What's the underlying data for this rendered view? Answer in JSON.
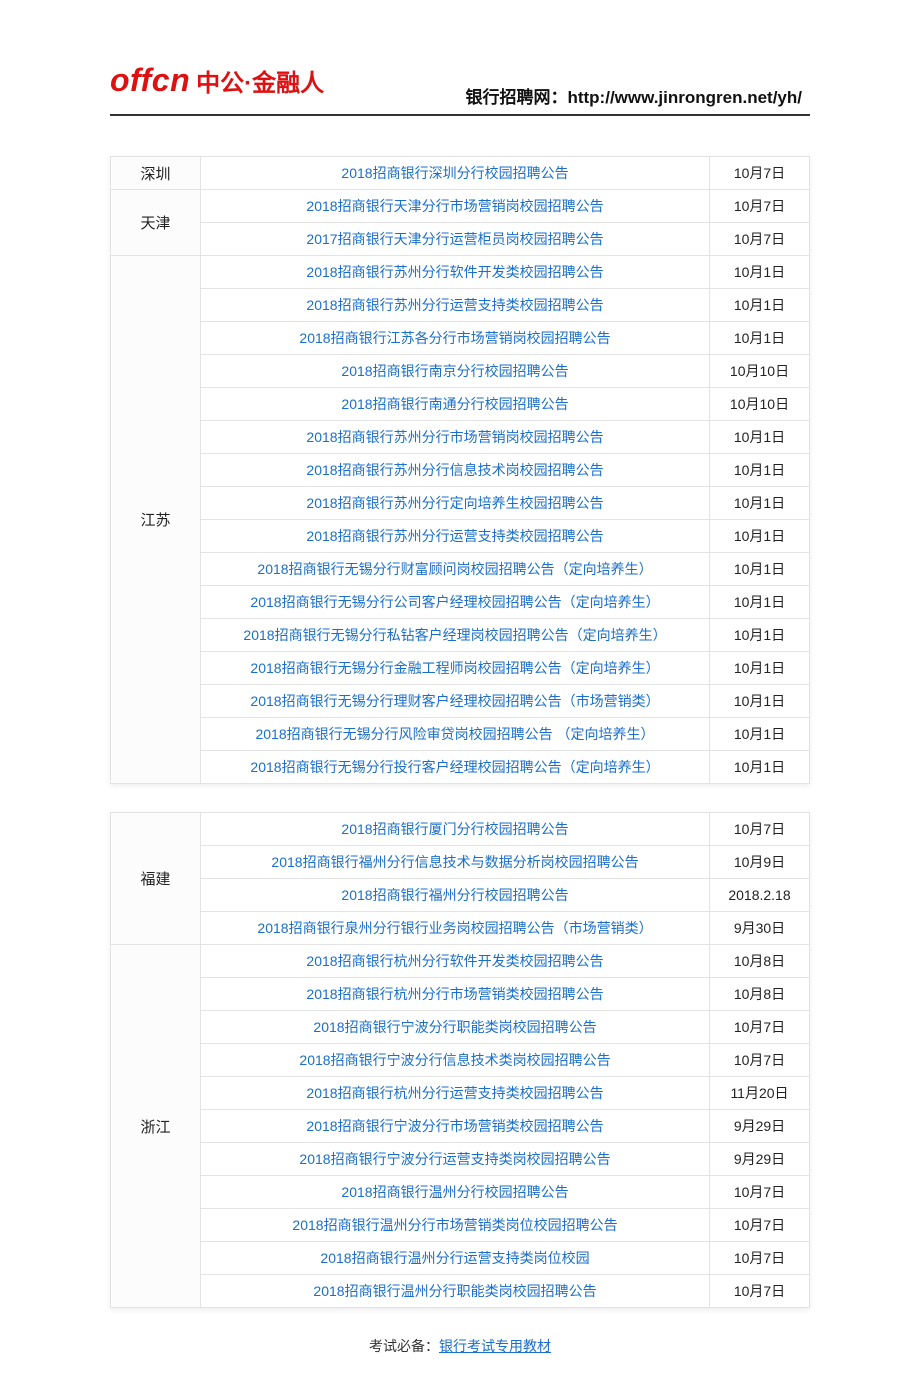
{
  "header": {
    "logo_offcn": "offcn",
    "logo_cn": "中公·金融人",
    "right_label": "银行招聘网：",
    "right_url": "http://www.jinrongren.net/yh/"
  },
  "table1": {
    "groups": [
      {
        "region": "深圳",
        "rows": [
          {
            "title": "2018招商银行深圳分行校园招聘公告",
            "date": "10月7日"
          }
        ]
      },
      {
        "region": "天津",
        "rows": [
          {
            "title": "2018招商银行天津分行市场营销岗校园招聘公告",
            "date": "10月7日"
          },
          {
            "title": "2017招商银行天津分行运营柜员岗校园招聘公告",
            "date": "10月7日"
          }
        ]
      },
      {
        "region": "江苏",
        "rows": [
          {
            "title": "2018招商银行苏州分行软件开发类校园招聘公告",
            "date": "10月1日"
          },
          {
            "title": "2018招商银行苏州分行运营支持类校园招聘公告",
            "date": "10月1日"
          },
          {
            "title": "2018招商银行江苏各分行市场营销岗校园招聘公告",
            "date": "10月1日"
          },
          {
            "title": "2018招商银行南京分行校园招聘公告",
            "date": "10月10日"
          },
          {
            "title": "2018招商银行南通分行校园招聘公告",
            "date": "10月10日"
          },
          {
            "title": "2018招商银行苏州分行市场营销岗校园招聘公告",
            "date": "10月1日"
          },
          {
            "title": "2018招商银行苏州分行信息技术岗校园招聘公告",
            "date": "10月1日"
          },
          {
            "title": "2018招商银行苏州分行定向培养生校园招聘公告",
            "date": "10月1日"
          },
          {
            "title": "2018招商银行苏州分行运营支持类校园招聘公告",
            "date": "10月1日"
          },
          {
            "title": "2018招商银行无锡分行财富顾问岗校园招聘公告（定向培养生）",
            "date": "10月1日"
          },
          {
            "title": "2018招商银行无锡分行公司客户经理校园招聘公告（定向培养生）",
            "date": "10月1日"
          },
          {
            "title": "2018招商银行无锡分行私钻客户经理岗校园招聘公告（定向培养生）",
            "date": "10月1日"
          },
          {
            "title": "2018招商银行无锡分行金融工程师岗校园招聘公告（定向培养生）",
            "date": "10月1日"
          },
          {
            "title": "2018招商银行无锡分行理财客户经理校园招聘公告（市场营销类）",
            "date": "10月1日"
          },
          {
            "title": "2018招商银行无锡分行风险审贷岗校园招聘公告 （定向培养生）",
            "date": "10月1日"
          },
          {
            "title": "2018招商银行无锡分行投行客户经理校园招聘公告（定向培养生）",
            "date": "10月1日"
          }
        ]
      }
    ]
  },
  "table2": {
    "groups": [
      {
        "region": "福建",
        "rows": [
          {
            "title": "2018招商银行厦门分行校园招聘公告",
            "date": "10月7日"
          },
          {
            "title": "2018招商银行福州分行信息技术与数据分析岗校园招聘公告",
            "date": "10月9日"
          },
          {
            "title": "2018招商银行福州分行校园招聘公告",
            "date": "2018.2.18"
          },
          {
            "title": "2018招商银行泉州分行银行业务岗校园招聘公告（市场营销类）",
            "date": "9月30日"
          }
        ]
      },
      {
        "region": "浙江",
        "rows": [
          {
            "title": "2018招商银行杭州分行软件开发类校园招聘公告",
            "date": "10月8日"
          },
          {
            "title": "2018招商银行杭州分行市场营销类校园招聘公告",
            "date": "10月8日"
          },
          {
            "title": "2018招商银行宁波分行职能类岗校园招聘公告",
            "date": "10月7日"
          },
          {
            "title": "2018招商银行宁波分行信息技术类岗校园招聘公告",
            "date": "10月7日"
          },
          {
            "title": "2018招商银行杭州分行运营支持类校园招聘公告",
            "date": "11月20日"
          },
          {
            "title": "2018招商银行宁波分行市场营销类校园招聘公告",
            "date": "9月29日"
          },
          {
            "title": "2018招商银行宁波分行运营支持类岗校园招聘公告",
            "date": "9月29日"
          },
          {
            "title": "2018招商银行温州分行校园招聘公告",
            "date": "10月7日"
          },
          {
            "title": "2018招商银行温州分行市场营销类岗位校园招聘公告",
            "date": "10月7日"
          },
          {
            "title": "2018招商银行温州分行运营支持类岗位校园",
            "date": "10月7日"
          },
          {
            "title": "2018招商银行温州分行职能类岗校园招聘公告",
            "date": "10月7日"
          }
        ]
      }
    ]
  },
  "footer": {
    "prefix": "考试必备：",
    "link_text": "银行考试专用教材"
  }
}
